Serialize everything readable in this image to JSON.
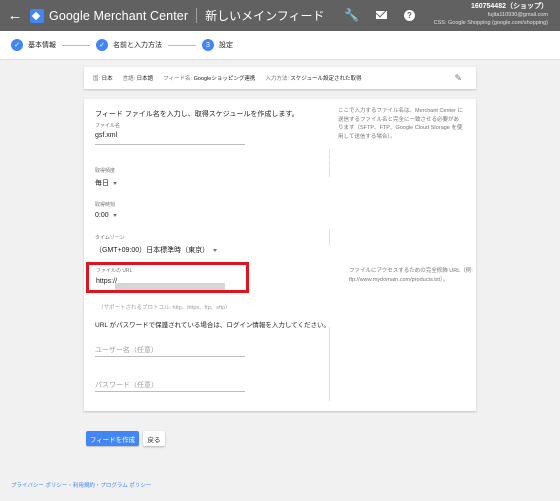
{
  "topbar": {
    "back_icon": "arrow-back-icon",
    "brand": "Google Merchant Center",
    "page_title": "新しいメインフィード",
    "icons": [
      "wrench-icon",
      "mail-icon",
      "help-icon"
    ],
    "account": {
      "name": "160754482（ショップ）",
      "email": "fujita110930@gmail.com",
      "css": "CSS: Google Shopping (google.com/shopping)"
    }
  },
  "stepper": {
    "steps": [
      {
        "label": "基本情報",
        "state": "done"
      },
      {
        "label": "名前と入力方法",
        "state": "done"
      },
      {
        "label": "設定",
        "number": "3",
        "state": "current"
      }
    ]
  },
  "summary": {
    "country_label": "国:",
    "country": "日本",
    "language_label": "言語:",
    "language": "日本語",
    "feed_label": "フィード名:",
    "feed": "Googleショッピング連携",
    "method_label": "入力方法:",
    "method": "スケジュール設定された取得"
  },
  "form": {
    "intro": "フィード ファイル名を入力し、取得スケジュールを作成します。",
    "filename_label": "ファイル名",
    "filename_value": "gsf.xml",
    "filename_help": "ここで入力するファイル名は、Merchant Center に送信するファイル名と完全に一致させる必要があります（SFTP、FTP、Google Cloud Storage を使用して送信する場合）。",
    "frequency_label": "取得頻度",
    "frequency_value": "毎日",
    "time_label": "取得時刻",
    "time_value": "0:00",
    "timezone_label": "タイムゾーン",
    "timezone_value": "（GMT+09:00）日本標準時（東京）",
    "url_label": "ファイルの URL",
    "url_value": "https://",
    "url_help": "ファイルにアクセスするための完全修飾 URL（例: ftp://www.mydomain.com/products.txt）。",
    "protocols_note": "（サポートされるプロトコル: http、https、ftp、sftp）",
    "auth_text": "URL がパスワードで保護されている場合は、ログイン情報を入力してください。",
    "username_placeholder": "ユーザー名（任意）",
    "password_placeholder": "パスワード（任意）"
  },
  "actions": {
    "create": "フィードを作成",
    "back": "戻る"
  },
  "footer": "プライバシー ポリシー・利用規約・プログラム ポリシー",
  "colors": {
    "accent": "#4285f4",
    "highlight": "#e0141f",
    "topbar": "#616161"
  }
}
